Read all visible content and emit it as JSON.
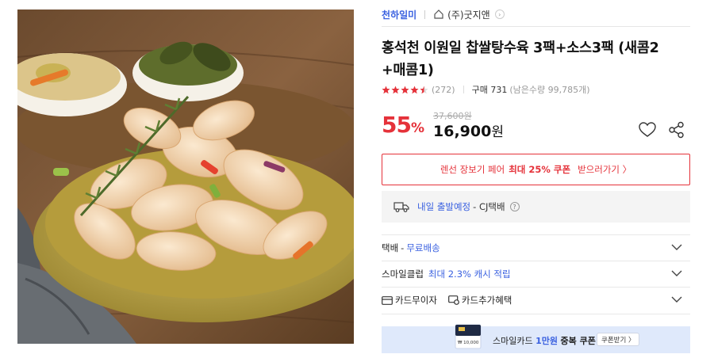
{
  "product_image": {
    "alt": "sweet and sour pork in a yellow bowl"
  },
  "seller": {
    "brand": "천하일미",
    "shop": "(주)굿지앤",
    "home_icon": "home-icon",
    "go_icon": "chevron-right-icon"
  },
  "product": {
    "title_line1": "홍석천 이원일 찹쌀탕수육 3팩+소스3팩 (새콤2",
    "title_line2": "+매콤1)"
  },
  "rating": {
    "stars": 4.5,
    "review_count": "(272)",
    "sold": "구매 731",
    "remaining": "(남은수량 99,785개)"
  },
  "price": {
    "discount": "55",
    "discount_unit": "%",
    "original": "37,600원",
    "sale": "16,900",
    "sale_unit": "원",
    "heart_icon": "heart-icon",
    "share_icon": "share-icon"
  },
  "coupon_banner": {
    "prefix": "렌선 장보기 페어",
    "highlight": "최대 25% 쿠폰",
    "action": "받으러가기 〉"
  },
  "shipping": {
    "icon": "truck-icon",
    "dispatch": "내일 출발예정",
    "carrier": "- CJ택배",
    "help": "?"
  },
  "accordion": [
    {
      "label": "택배",
      "dash": "-",
      "value": "무료배송"
    },
    {
      "label": "스마일클럽",
      "dash": "",
      "value": "최대 2.3% 캐시 적립"
    },
    {
      "label": "카드무이자",
      "label2": "카드추가혜택"
    }
  ],
  "smile_banner": {
    "text_prefix": "스마일카드",
    "text_highlight": "1만원",
    "text_suffix": "중복 쿠폰",
    "button": "쿠폰받기 〉",
    "card_amount": "₩ 10,000"
  },
  "colors": {
    "accent_red": "#e5323a",
    "accent_blue": "#3a61e0",
    "star": "#e5323a",
    "banner_bg": "#dfe9fb"
  }
}
